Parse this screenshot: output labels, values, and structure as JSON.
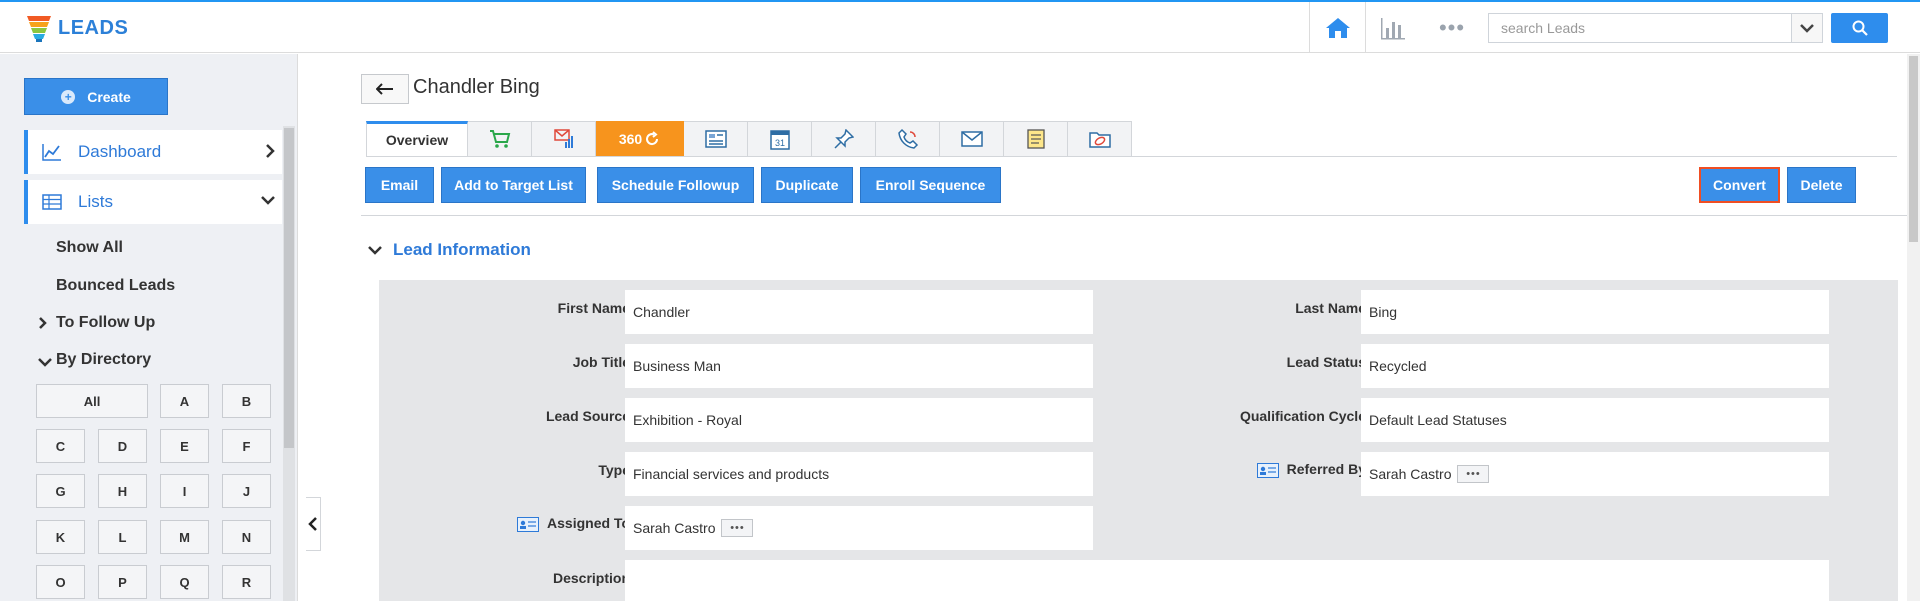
{
  "app": {
    "title": "LEADS"
  },
  "search": {
    "placeholder": "search Leads"
  },
  "sidebar": {
    "create_label": "Create",
    "dashboard_label": "Dashboard",
    "lists_label": "Lists",
    "show_all": "Show All",
    "bounced": "Bounced Leads",
    "follow_up": "To Follow Up",
    "by_directory": "By Directory",
    "letters": [
      "All",
      "A",
      "B",
      "C",
      "D",
      "E",
      "F",
      "G",
      "H",
      "I",
      "J",
      "K",
      "L",
      "M",
      "N",
      "O",
      "P",
      "Q",
      "R"
    ]
  },
  "record": {
    "name": "Chandler Bing"
  },
  "tabs": {
    "overview": "Overview",
    "t360": "360"
  },
  "actions": {
    "email": "Email",
    "add_target": "Add to Target List",
    "schedule": "Schedule Followup",
    "duplicate": "Duplicate",
    "enroll": "Enroll Sequence",
    "convert": "Convert",
    "delete": "Delete"
  },
  "section": {
    "title": "Lead Information"
  },
  "fields": {
    "first_name": {
      "label": "First Name",
      "value": "Chandler"
    },
    "last_name": {
      "label": "Last Name",
      "value": "Bing"
    },
    "job_title": {
      "label": "Job Title",
      "value": "Business Man"
    },
    "lead_status": {
      "label": "Lead Status",
      "value": "Recycled"
    },
    "lead_source": {
      "label": "Lead Source",
      "value": "Exhibition - Royal"
    },
    "qual_cycle": {
      "label": "Qualification Cycle",
      "value": "Default Lead Statuses"
    },
    "type": {
      "label": "Type",
      "value": "Financial services and products"
    },
    "referred_by": {
      "label": "Referred By",
      "value": "Sarah Castro"
    },
    "assigned_to": {
      "label": "Assigned To",
      "value": "Sarah Castro"
    },
    "description": {
      "label": "Description",
      "value": ""
    }
  },
  "colors": {
    "accent": "#2e8ded",
    "orange": "#f7941d",
    "convert_border": "#f04e23"
  }
}
